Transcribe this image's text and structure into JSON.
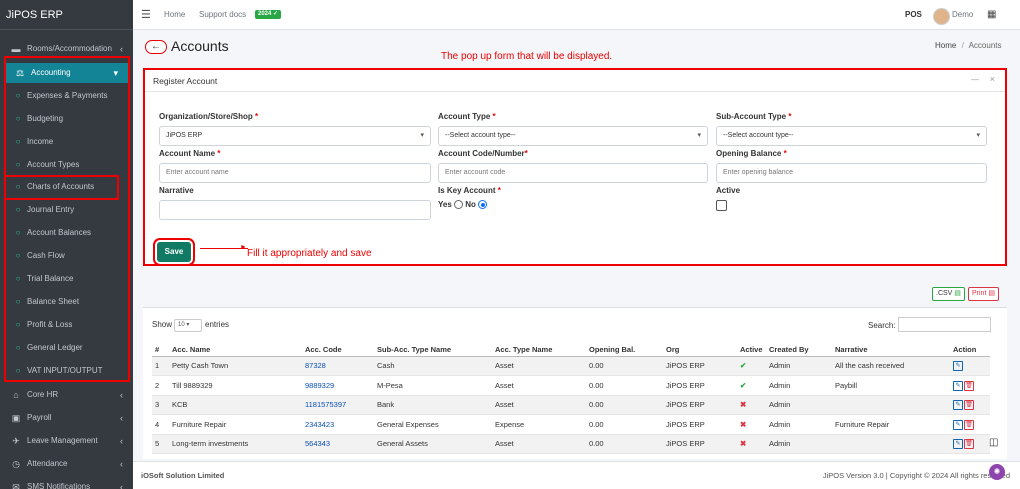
{
  "app": {
    "brand": "JiPOS ERP"
  },
  "sidebar": {
    "items": [
      {
        "label": "Rooms/Accommodation",
        "icon": "bed-icon",
        "chevron": "‹"
      },
      {
        "label": "Accounting",
        "icon": "scale-icon",
        "chevron": "▾"
      },
      {
        "label": "Expenses & Payments"
      },
      {
        "label": "Budgeting"
      },
      {
        "label": "Income"
      },
      {
        "label": "Account Types"
      },
      {
        "label": "Charts of Accounts"
      },
      {
        "label": "Journal Entry"
      },
      {
        "label": "Account Balances"
      },
      {
        "label": "Cash Flow"
      },
      {
        "label": "Trial Balance"
      },
      {
        "label": "Balance Sheet"
      },
      {
        "label": "Profit & Loss"
      },
      {
        "label": "General Ledger"
      },
      {
        "label": "VAT INPUT/OUTPUT"
      },
      {
        "label": "Core HR",
        "icon": "bank-icon",
        "chevron": "‹"
      },
      {
        "label": "Payroll",
        "icon": "money-icon",
        "chevron": "‹"
      },
      {
        "label": "Leave Management",
        "icon": "plane-icon",
        "chevron": "‹"
      },
      {
        "label": "Attendance",
        "icon": "clock-icon",
        "chevron": "‹"
      },
      {
        "label": "SMS Notifications",
        "icon": "sms-icon",
        "chevron": "‹"
      }
    ]
  },
  "topbar": {
    "home": "Home",
    "support": "Support docs",
    "badge": "2024",
    "pos": "POS",
    "user": "Demo"
  },
  "page": {
    "title": "Accounts",
    "breadcrumb_home": "Home",
    "breadcrumb_sep": "/",
    "breadcrumb_current": "Accounts"
  },
  "annotations": {
    "popup_note": "The pop up form that will be displayed.",
    "save_note": "Fill it appropriately and save"
  },
  "form": {
    "title": "Register Account",
    "minimize": "—",
    "close": "×",
    "org_label": "Organization/Store/Shop",
    "org_value": "JiPOS ERP",
    "type_label": "Account Type",
    "type_value": "--Select account type--",
    "subtype_label": "Sub-Account Type",
    "subtype_value": "--Select account type--",
    "name_label": "Account Name",
    "name_placeholder": "Enter account name",
    "code_label": "Account Code/Number",
    "code_placeholder": "Enter account code",
    "balance_label": "Opening Balance",
    "balance_placeholder": "Enter opening balance",
    "narrative_label": "Narrative",
    "key_label": "Is Key Account",
    "yes": "Yes",
    "no": "No",
    "active_label": "Active",
    "save": "Save",
    "req": "*"
  },
  "table": {
    "csv": ".CSV",
    "print": "Print",
    "show": "Show",
    "show_value": "10",
    "entries": "entries",
    "search": "Search:",
    "headers": [
      "#",
      "Acc. Name",
      "Acc. Code",
      "Sub-Acc. Type Name",
      "Acc. Type Name",
      "Opening Bal.",
      "Org",
      "Active",
      "Created By",
      "Narrative",
      "Action"
    ],
    "rows": [
      {
        "n": "1",
        "name": "Petty Cash Town",
        "code": "87328",
        "sub": "Cash",
        "type": "Asset",
        "bal": "0.00",
        "org": "JiPOS ERP",
        "active": true,
        "by": "Admin",
        "narr": "All the cash received"
      },
      {
        "n": "2",
        "name": "Till 9889329",
        "code": "9889329",
        "sub": "M-Pesa",
        "type": "Asset",
        "bal": "0.00",
        "org": "JiPOS ERP",
        "active": true,
        "by": "Admin",
        "narr": "Paybill"
      },
      {
        "n": "3",
        "name": "KCB",
        "code": "1181575397",
        "sub": "Bank",
        "type": "Asset",
        "bal": "0.00",
        "org": "JiPOS ERP",
        "active": false,
        "by": "Admin",
        "narr": ""
      },
      {
        "n": "4",
        "name": "Furniture Repair",
        "code": "2343423",
        "sub": "General Expenses",
        "type": "Expense",
        "bal": "0.00",
        "org": "JiPOS ERP",
        "active": false,
        "by": "Admin",
        "narr": "Furniture Repair"
      },
      {
        "n": "5",
        "name": "Long-term investments",
        "code": "564343",
        "sub": "General Assets",
        "type": "Asset",
        "bal": "0.00",
        "org": "JiPOS ERP",
        "active": false,
        "by": "Admin",
        "narr": ""
      }
    ]
  },
  "footer": {
    "company": "iOSoft Solution Limited",
    "version": "JiPOS Version 3.0 | Copyright © 2024 All rights reserved"
  },
  "colors": {
    "accent": "#138496",
    "annotation": "#e00000",
    "sidebar": "#343a40"
  }
}
